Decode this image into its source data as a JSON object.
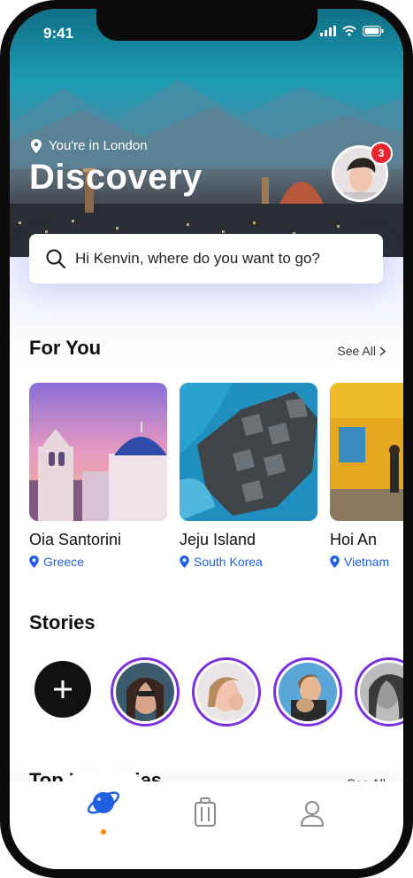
{
  "status_bar": {
    "time": "9:41"
  },
  "header": {
    "location_text": "You're in London",
    "title": "Discovery",
    "notification_count": "3"
  },
  "search": {
    "placeholder": "Hi Kenvin, where do you want to go?"
  },
  "for_you": {
    "title": "For You",
    "see_all": "See All",
    "cards": [
      {
        "name": "Oia Santorini",
        "country": "Greece"
      },
      {
        "name": "Jeju Island",
        "country": "South Korea"
      },
      {
        "name": "Hoi An",
        "country": "Vietnam"
      }
    ]
  },
  "stories": {
    "title": "Stories"
  },
  "next_section": {
    "title": "Top Itineraries",
    "see_all": "See All"
  },
  "tabbar": {
    "items": [
      "explore",
      "trips",
      "profile"
    ],
    "active": "explore"
  },
  "colors": {
    "accent": "#1f5fe0",
    "story_ring": "#7a2fe0",
    "badge": "#e8242f",
    "active_dot": "#ff8a00"
  },
  "icons": [
    "signal-icon",
    "wifi-icon",
    "battery-icon",
    "location-pin-icon",
    "search-icon",
    "plus-icon",
    "planet-icon",
    "luggage-icon",
    "user-icon",
    "chevron-right-icon"
  ]
}
